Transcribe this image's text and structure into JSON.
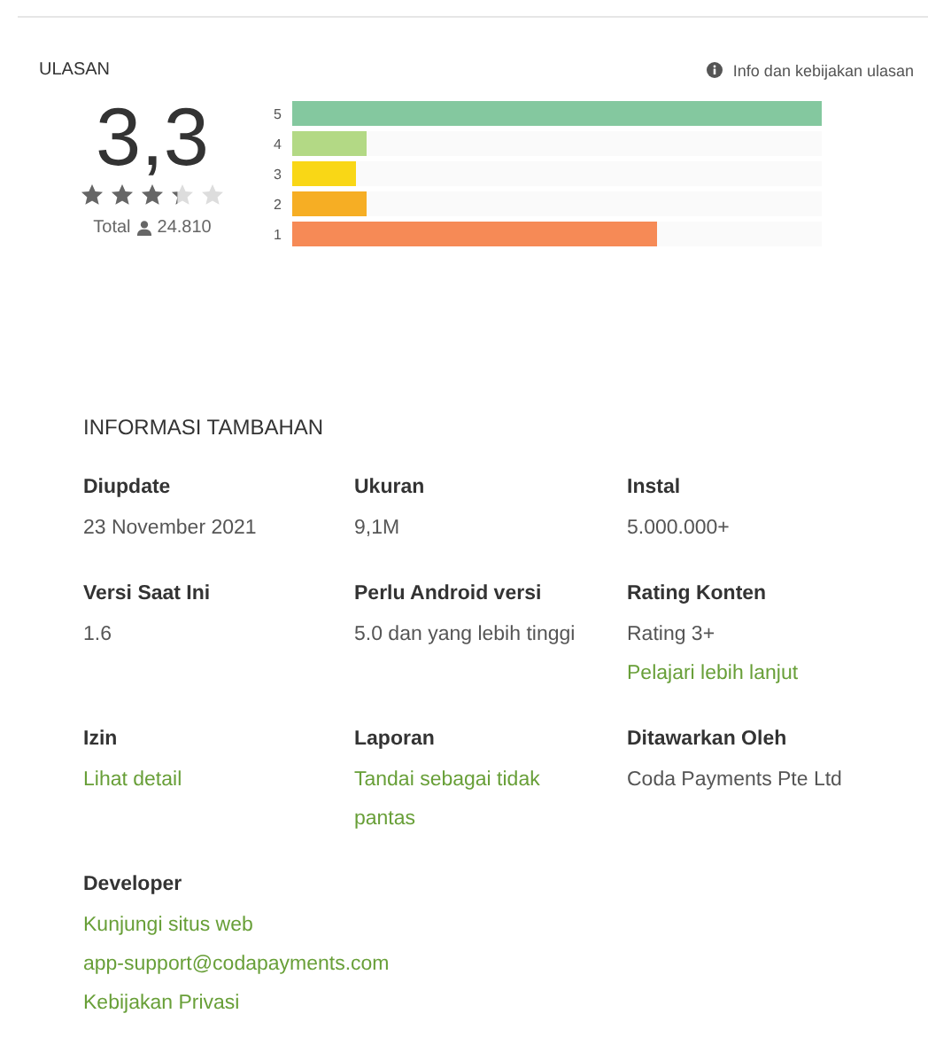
{
  "reviews": {
    "title": "ULASAN",
    "info_link": "Info dan kebijakan ulasan",
    "average": "3,3",
    "stars": 3.3,
    "total_label": "Total",
    "total_count": "24.810",
    "histogram": [
      {
        "label": "5",
        "level": 1.0,
        "color": "#84c89f"
      },
      {
        "label": "4",
        "level": 0.14,
        "color": "#b3d985"
      },
      {
        "label": "3",
        "level": 0.12,
        "color": "#f9d716"
      },
      {
        "label": "2",
        "level": 0.14,
        "color": "#f6ae24"
      },
      {
        "label": "1",
        "level": 0.69,
        "color": "#f68a56"
      }
    ]
  },
  "additional_info": {
    "title": "INFORMASI TAMBAHAN",
    "items": [
      {
        "label": "Diupdate",
        "values": [
          {
            "kind": "text",
            "text": "23 November 2021"
          }
        ]
      },
      {
        "label": "Ukuran",
        "values": [
          {
            "kind": "text",
            "text": "9,1M"
          }
        ]
      },
      {
        "label": "Instal",
        "values": [
          {
            "kind": "text",
            "text": "5.000.000+"
          }
        ]
      },
      {
        "label": "Versi Saat Ini",
        "values": [
          {
            "kind": "text",
            "text": "1.6"
          }
        ]
      },
      {
        "label": "Perlu Android versi",
        "values": [
          {
            "kind": "text",
            "text": "5.0 dan yang lebih tinggi"
          }
        ]
      },
      {
        "label": "Rating Konten",
        "values": [
          {
            "kind": "text",
            "text": "Rating 3+"
          },
          {
            "kind": "link",
            "text": "Pelajari lebih lanjut"
          }
        ]
      },
      {
        "label": "Izin",
        "values": [
          {
            "kind": "link",
            "text": "Lihat detail"
          }
        ]
      },
      {
        "label": "Laporan",
        "values": [
          {
            "kind": "link",
            "text": "Tandai sebagai tidak pantas"
          }
        ]
      },
      {
        "label": "Ditawarkan Oleh",
        "values": [
          {
            "kind": "text",
            "text": "Coda Payments Pte Ltd"
          }
        ]
      },
      {
        "label": "Developer",
        "values": [
          {
            "kind": "link",
            "text": "Kunjungi situs web"
          },
          {
            "kind": "link",
            "text": "app-support@codapayments.com"
          },
          {
            "kind": "link",
            "text": "Kebijakan Privasi"
          }
        ]
      }
    ]
  }
}
